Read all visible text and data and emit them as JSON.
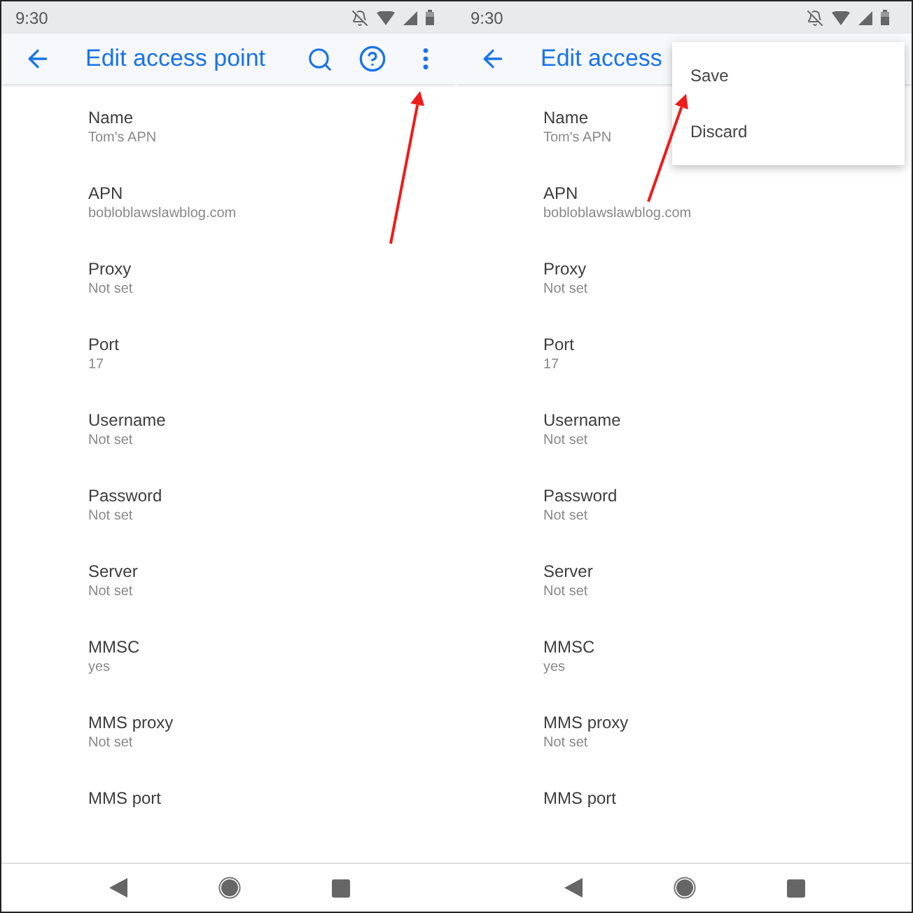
{
  "screens": [
    {
      "status_bar": {
        "time": "9:30"
      },
      "toolbar": {
        "title": "Edit access point"
      },
      "fields": [
        {
          "label": "Name",
          "value": "Tom's APN"
        },
        {
          "label": "APN",
          "value": "bobloblawslawblog.com"
        },
        {
          "label": "Proxy",
          "value": "Not set"
        },
        {
          "label": "Port",
          "value": "17"
        },
        {
          "label": "Username",
          "value": "Not set"
        },
        {
          "label": "Password",
          "value": "Not set"
        },
        {
          "label": "Server",
          "value": "Not set"
        },
        {
          "label": "MMSC",
          "value": "yes"
        },
        {
          "label": "MMS proxy",
          "value": "Not set"
        },
        {
          "label": "MMS port"
        }
      ],
      "annotations": [
        {
          "kind": "arrow"
        }
      ]
    },
    {
      "status_bar": {
        "time": "9:30"
      },
      "toolbar": {
        "title": "Edit access"
      },
      "menu": [
        "Save",
        "Discard"
      ],
      "fields": [
        {
          "label": "Name",
          "value": "Tom's APN"
        },
        {
          "label": "APN",
          "value": "bobloblawslawblog.com"
        },
        {
          "label": "Proxy",
          "value": "Not set"
        },
        {
          "label": "Port",
          "value": "17"
        },
        {
          "label": "Username",
          "value": "Not set"
        },
        {
          "label": "Password",
          "value": "Not set"
        },
        {
          "label": "Server",
          "value": "Not set"
        },
        {
          "label": "MMSC",
          "value": "yes"
        },
        {
          "label": "MMS proxy",
          "value": "Not set"
        },
        {
          "label": "MMS port"
        }
      ],
      "annotations": [
        {
          "kind": "arrow"
        }
      ]
    }
  ]
}
